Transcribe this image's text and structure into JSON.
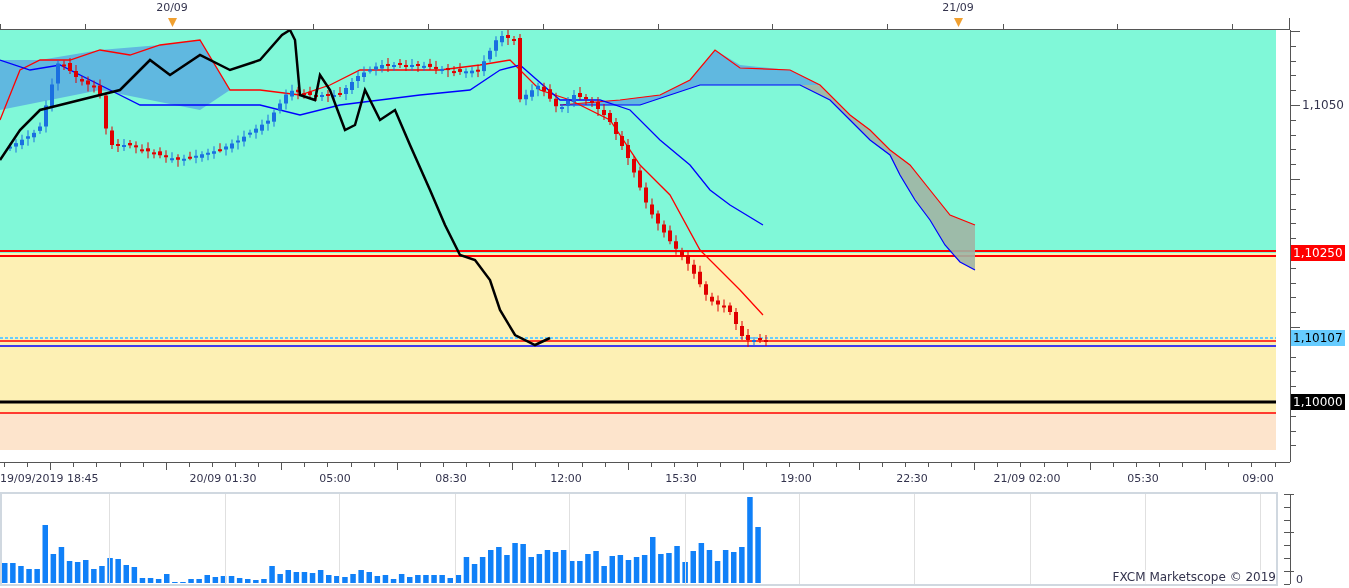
{
  "date_markers": [
    "20/09",
    "21/09"
  ],
  "price_labels": [
    {
      "text": "1,1050",
      "kind": "plain"
    },
    {
      "text": "1,10250",
      "kind": "marker",
      "color": "#ff0000"
    },
    {
      "text": "1,10107",
      "kind": "marker",
      "color": "#66ccff"
    },
    {
      "text": "1,10000",
      "kind": "marker",
      "color": "#000000"
    }
  ],
  "time_labels": [
    "19/09/2019 18:45",
    "20/09 01:30",
    "05:00",
    "08:30",
    "12:00",
    "15:30",
    "19:00",
    "22:30",
    "21/09 02:00",
    "05:30",
    "09:00"
  ],
  "volume_panel": {
    "axis_label": "0",
    "credit": "FXCM Marketscope © 2019"
  }
}
